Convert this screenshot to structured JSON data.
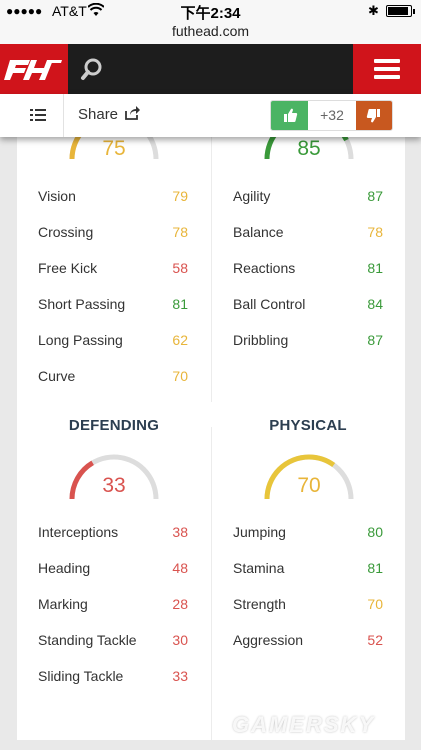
{
  "status_bar": {
    "signal": "●●●●●",
    "carrier": "AT&T",
    "time": "下午2:34"
  },
  "url": "futhead.com",
  "header": {
    "logo_text": "FH",
    "logo_icon": "futhead-logo",
    "search_icon": "search-icon",
    "menu_icon": "hamburger-menu-icon",
    "accent_color": "#d0141b"
  },
  "share_bar": {
    "share_label": "Share",
    "vote_count": "+32",
    "upvote_color": "#4bb464",
    "downvote_color": "#c8581f"
  },
  "colors": {
    "high": "#3a9a3a",
    "mid": "#e8b53a",
    "low": "#d9534f"
  },
  "top_gauges": [
    {
      "value": "75",
      "level": 0.75,
      "color": "#e8b53a"
    },
    {
      "value": "85",
      "level": 0.85,
      "color": "#3a9a3a"
    }
  ],
  "passing_stats": [
    {
      "name": "Vision",
      "value": "79",
      "tier": "mid"
    },
    {
      "name": "Crossing",
      "value": "78",
      "tier": "mid"
    },
    {
      "name": "Free Kick",
      "value": "58",
      "tier": "low"
    },
    {
      "name": "Short Passing",
      "value": "81",
      "tier": "high"
    },
    {
      "name": "Long Passing",
      "value": "62",
      "tier": "mid"
    },
    {
      "name": "Curve",
      "value": "70",
      "tier": "mid"
    }
  ],
  "dribbling_stats": [
    {
      "name": "Agility",
      "value": "87",
      "tier": "high"
    },
    {
      "name": "Balance",
      "value": "78",
      "tier": "mid"
    },
    {
      "name": "Reactions",
      "value": "81",
      "tier": "high"
    },
    {
      "name": "Ball Control",
      "value": "84",
      "tier": "high"
    },
    {
      "name": "Dribbling",
      "value": "87",
      "tier": "high"
    }
  ],
  "defending": {
    "title": "DEFENDING",
    "value": "33",
    "level": 0.33,
    "color": "#d9534f",
    "stats": [
      {
        "name": "Interceptions",
        "value": "38",
        "tier": "low"
      },
      {
        "name": "Heading",
        "value": "48",
        "tier": "low"
      },
      {
        "name": "Marking",
        "value": "28",
        "tier": "low"
      },
      {
        "name": "Standing Tackle",
        "value": "30",
        "tier": "low"
      },
      {
        "name": "Sliding Tackle",
        "value": "33",
        "tier": "low"
      }
    ]
  },
  "physical": {
    "title": "PHYSICAL",
    "value": "70",
    "level": 0.7,
    "color": "#e8c53a",
    "stats": [
      {
        "name": "Jumping",
        "value": "80",
        "tier": "high"
      },
      {
        "name": "Stamina",
        "value": "81",
        "tier": "high"
      },
      {
        "name": "Strength",
        "value": "70",
        "tier": "mid"
      },
      {
        "name": "Aggression",
        "value": "52",
        "tier": "low"
      }
    ]
  },
  "watermark": "GAMERSKY"
}
